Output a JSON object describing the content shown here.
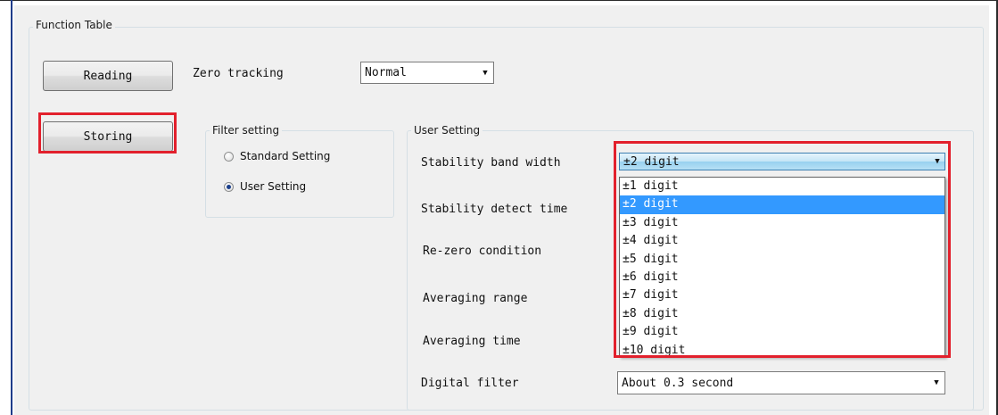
{
  "function_table": {
    "title": "Function Table",
    "buttons": {
      "reading": "Reading",
      "storing": "Storing"
    },
    "zero_tracking": {
      "label": "Zero tracking",
      "value": "Normal"
    },
    "filter_setting": {
      "title": "Filter setting",
      "options": [
        {
          "label": "Standard Setting",
          "checked": false
        },
        {
          "label": "User Setting",
          "checked": true
        }
      ]
    },
    "user_setting": {
      "title": "User Setting",
      "stability_band_width": {
        "label": "Stability band width",
        "value": "±2 digit",
        "options": [
          "±1 digit",
          "±2 digit",
          "±3 digit",
          "±4 digit",
          "±5 digit",
          "±6 digit",
          "±7 digit",
          "±8 digit",
          "±9 digit",
          "±10 digit"
        ],
        "selected": "±2 digit"
      },
      "stability_detect_time": {
        "label": "Stability detect time"
      },
      "re_zero_condition": {
        "label": "Re-zero condition"
      },
      "averaging_range": {
        "label": "Averaging range"
      },
      "averaging_time": {
        "label": "Averaging time"
      },
      "digital_filter": {
        "label": "Digital filter",
        "value": "About 0.3 second"
      }
    }
  },
  "colors": {
    "highlight": "#e2202c",
    "selection": "#3399ff",
    "window_background": "#f0f0f0"
  }
}
